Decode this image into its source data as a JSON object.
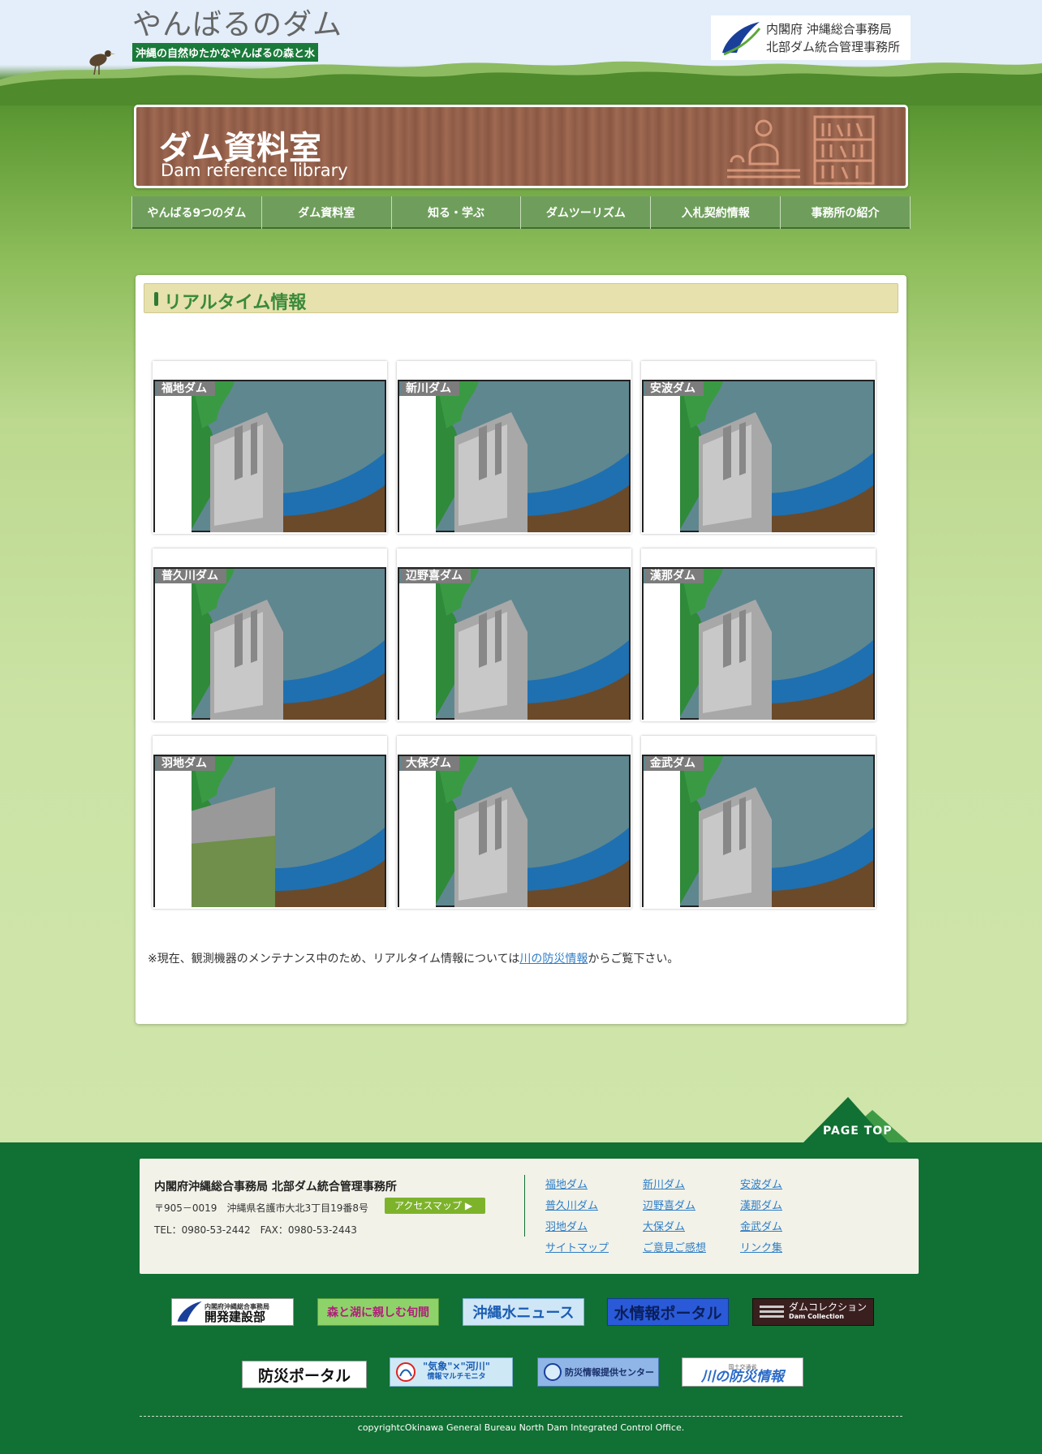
{
  "header": {
    "site_title": "やんばるのダム",
    "tagline": "沖縄の自然ゆたかなやんばるの森と水",
    "agency_line1": "内閣府 沖縄総合事務局",
    "agency_line2": "北部ダム統合管理事務所"
  },
  "banner": {
    "title_ja": "ダム資料室",
    "title_en": "Dam reference library"
  },
  "nav": [
    "やんばる9つのダム",
    "ダム資料室",
    "知る・学ぶ",
    "ダムツーリズム",
    "入札契約情報",
    "事務所の紹介"
  ],
  "main": {
    "section_title": "リアルタイム情報",
    "dams": [
      "福地ダム",
      "新川ダム",
      "安波ダム",
      "普久川ダム",
      "辺野喜ダム",
      "漢那ダム",
      "羽地ダム",
      "大保ダム",
      "金武ダム"
    ],
    "note_before": "※現在、観測機器のメンテナンス中のため、リアルタイム情報については",
    "note_link": "川の防災情報",
    "note_after": "からご覧下さい。"
  },
  "page_top": "PAGE TOP",
  "footer": {
    "org": "内閣府沖縄総合事務局 北部ダム統合管理事務所",
    "address": "〒905－0019　沖縄県名護市大北3丁目19番8号",
    "access_button": "アクセスマップ",
    "tel": "TEL：0980-53-2442　FAX：0980-53-2443",
    "links": [
      "福地ダム",
      "新川ダム",
      "安波ダム",
      "普久川ダム",
      "辺野喜ダム",
      "漢那ダム",
      "羽地ダム",
      "大保ダム",
      "金武ダム",
      "サイトマップ",
      "ご意見ご感想",
      "リンク集"
    ],
    "banners_row1": [
      "内閣府沖縄総合事務局",
      "開発建設部",
      "森と湖に親しむ旬間",
      "沖縄水ニュース",
      "水情報ポータル",
      "ダムコレクション",
      "Dam Collection"
    ],
    "banners_row2": [
      "防災ポータル",
      "\"気象\"×\"河川\"",
      "情報マルチモニタ",
      "防災情報提供センター",
      "国土交通省",
      "川の防災情報"
    ],
    "copyright": "copyrightcOkinawa General Bureau North Dam Integrated Control Office."
  },
  "colors": {
    "footer_green": "#117033",
    "nav_green": "#6f9e5c",
    "link_blue": "#2e7ec7"
  }
}
